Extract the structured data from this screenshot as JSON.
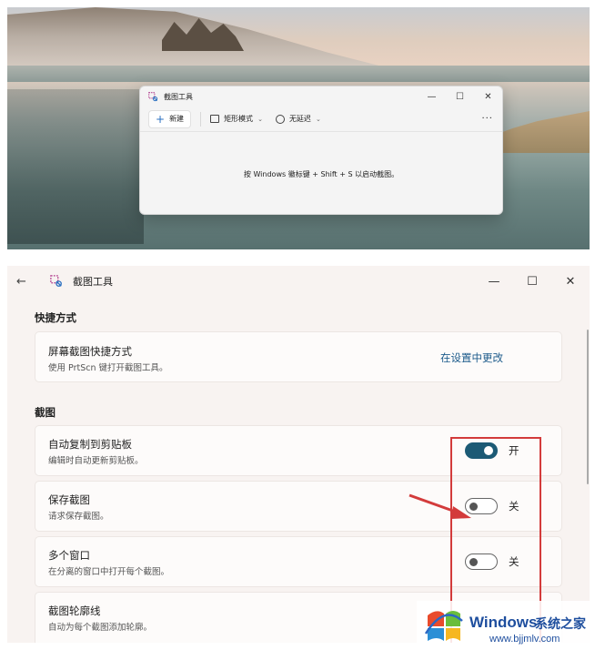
{
  "snip_window": {
    "title": "截图工具",
    "controls": [
      "—",
      "☐",
      "✕"
    ],
    "new_label": "新建",
    "mode_label": "矩形模式",
    "delay_label": "无延迟",
    "more": "···",
    "hint": "按 Windows 徽标键 + Shift + S 以启动截图。"
  },
  "settings": {
    "title": "截图工具",
    "back": "←",
    "controls": [
      "—",
      "☐",
      "✕"
    ],
    "shortcuts_header": "快捷方式",
    "shortcut_card": {
      "title": "屏幕截图快捷方式",
      "desc": "使用 PrtScn 键打开截图工具。",
      "link": "在设置中更改"
    },
    "snipping_header": "截图",
    "options": [
      {
        "title": "自动复制到剪贴板",
        "desc": "编辑时自动更新剪贴板。",
        "state": "开",
        "on": true
      },
      {
        "title": "保存截图",
        "desc": "请求保存截图。",
        "state": "关",
        "on": false
      },
      {
        "title": "多个窗口",
        "desc": "在分离的窗口中打开每个截图。",
        "state": "关",
        "on": false
      },
      {
        "title": "截图轮廓线",
        "desc": "自动为每个截图添加轮廓。"
      }
    ]
  },
  "watermark": {
    "brand": "Windows",
    "suffix": "系统之家",
    "url": "www.bjjmlv.com"
  },
  "colors": {
    "toggle_on": "#1c5a75",
    "link": "#1e5c8c",
    "highlight": "#d33b3b"
  }
}
